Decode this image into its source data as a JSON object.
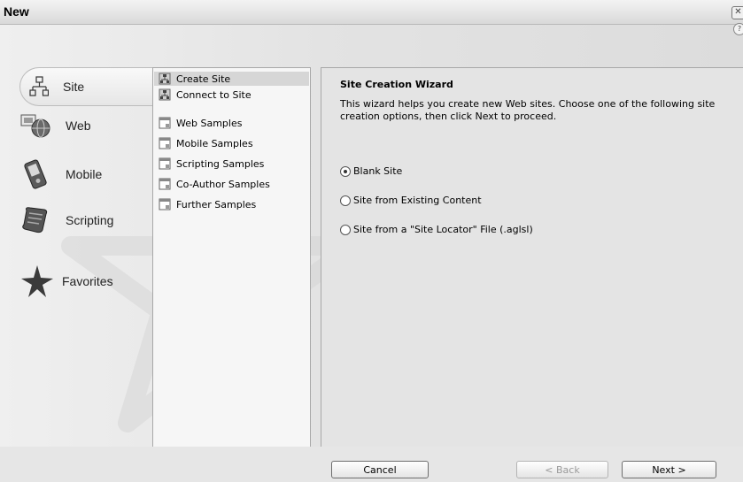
{
  "window": {
    "title": "New",
    "close_icon": "close-icon",
    "help_icon": "help-icon"
  },
  "categories": [
    {
      "label": "Site",
      "icon": "sitemap-icon",
      "selected": true
    },
    {
      "label": "Web",
      "icon": "globe-icon"
    },
    {
      "label": "Mobile",
      "icon": "mobile-device-icon"
    },
    {
      "label": "Scripting",
      "icon": "scroll-icon"
    },
    {
      "label": "Favorites",
      "icon": "star-icon"
    }
  ],
  "items": [
    {
      "label": "Create Site",
      "icon": "site-icon",
      "selected": true
    },
    {
      "label": "Connect to Site",
      "icon": "site-icon"
    },
    {
      "label": "Web Samples",
      "icon": "document-icon"
    },
    {
      "label": "Mobile Samples",
      "icon": "document-icon"
    },
    {
      "label": "Scripting Samples",
      "icon": "document-icon"
    },
    {
      "label": "Co-Author Samples",
      "icon": "document-icon"
    },
    {
      "label": "Further Samples",
      "icon": "document-icon"
    }
  ],
  "wizard": {
    "title": "Site Creation Wizard",
    "description": "This wizard helps you create new Web sites. Choose one of the following site creation options, then click Next to proceed.",
    "options": [
      {
        "label": "Blank Site",
        "checked": true
      },
      {
        "label": "Site from Existing Content",
        "checked": false
      },
      {
        "label": "Site from a \"Site Locator\" File (.aglsl)",
        "checked": false
      }
    ]
  },
  "buttons": {
    "cancel": "Cancel",
    "back": "< Back",
    "next": "Next >"
  }
}
